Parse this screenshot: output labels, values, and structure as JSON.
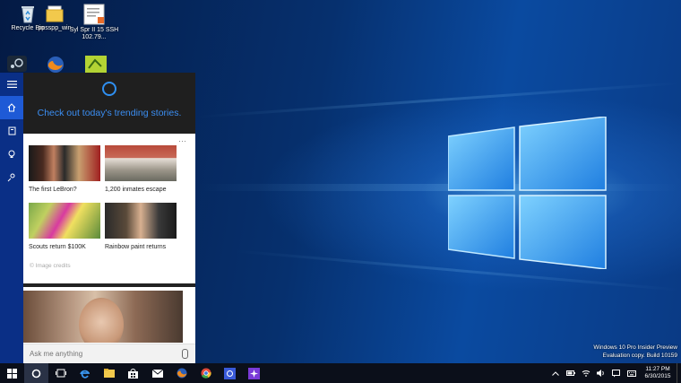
{
  "desktop": {
    "icons": [
      {
        "label": "Recycle Bin",
        "icon": "recycle-bin-icon"
      },
      {
        "label": "ppsspp_win",
        "icon": "folder-icon"
      },
      {
        "label": "Syl Spr II 15 SSH 102.79...",
        "icon": "document-icon"
      },
      {
        "label": "",
        "icon": "steam-icon"
      },
      {
        "label": "",
        "icon": "firefox-icon"
      },
      {
        "label": "",
        "icon": "app-icon"
      }
    ],
    "watermark": {
      "line1": "Windows 10 Pro Insider Preview",
      "line2": "Evaluation copy. Build 10159"
    }
  },
  "cortana": {
    "rail": [
      "menu-icon",
      "home-icon",
      "notebook-icon",
      "lightbulb-icon",
      "feedback-icon"
    ],
    "headline": "Check out today's trending stories.",
    "more": "···",
    "news": [
      {
        "caption": "The first LeBron?"
      },
      {
        "caption": "1,200 inmates escape"
      },
      {
        "caption": "Scouts return $100K"
      },
      {
        "caption": "Rainbow paint returns"
      }
    ],
    "credits": "© Image credits",
    "ask_placeholder": "Ask me anything"
  },
  "taskbar": {
    "apps": [
      "start-icon",
      "cortana-icon",
      "task-view-icon",
      "edge-icon",
      "file-explorer-icon",
      "store-icon",
      "mail-icon",
      "firefox-icon",
      "chrome-icon",
      "app-blue-icon",
      "app-purple-icon"
    ],
    "clock": {
      "time": "11:27 PM",
      "date": "6/30/2015"
    }
  }
}
